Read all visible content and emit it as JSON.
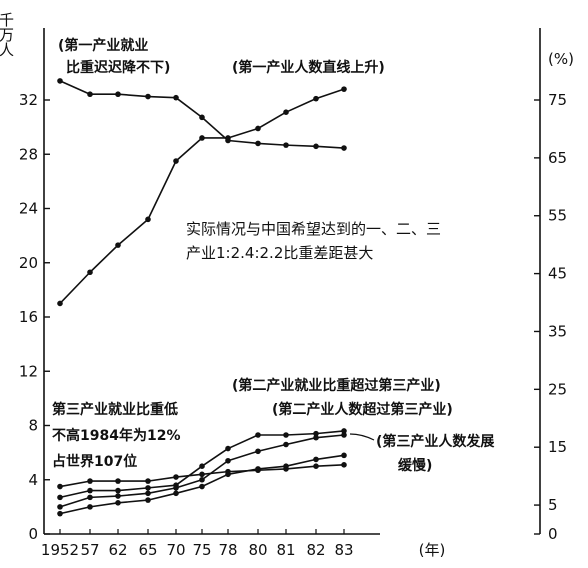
{
  "chart_data": {
    "type": "line",
    "left_axis": {
      "unit": "千万人",
      "ylim": [
        0,
        36
      ],
      "ticks": [
        0,
        4,
        8,
        12,
        16,
        20,
        24,
        28,
        32
      ]
    },
    "right_axis": {
      "unit": "(%)",
      "ylim": [
        0,
        85
      ],
      "ticks": [
        0,
        5,
        15,
        25,
        35,
        45,
        55,
        65,
        75
      ]
    },
    "x_labels": [
      "1952",
      "57",
      "62",
      "65",
      "70",
      "75",
      "78",
      "80",
      "81",
      "82",
      "83",
      "(年)"
    ],
    "categories": [
      "1952",
      "57",
      "62",
      "65",
      "70",
      "75",
      "78",
      "80",
      "81",
      "82",
      "83"
    ],
    "series": [
      {
        "axis": "left",
        "values": [
          17.0,
          19.3,
          21.3,
          23.2,
          27.5,
          29.2,
          29.2,
          29.9,
          31.1,
          32.1,
          32.8
        ]
      },
      {
        "axis": "right",
        "values": [
          78.3,
          76.0,
          76.0,
          75.6,
          75.4,
          72.0,
          68.0,
          67.5,
          67.2,
          67.0,
          66.7
        ]
      },
      {
        "axis": "left",
        "values": [
          3.5,
          3.9,
          3.9,
          3.9,
          4.2,
          4.4,
          4.6,
          4.7,
          4.8,
          5.0,
          5.1
        ]
      },
      {
        "axis": "left",
        "values": [
          2.7,
          3.2,
          3.2,
          3.4,
          3.6,
          5.0,
          6.3,
          7.3,
          7.3,
          7.4,
          7.6
        ]
      },
      {
        "axis": "left",
        "values": [
          2.0,
          2.7,
          2.8,
          3.0,
          3.4,
          4.0,
          5.4,
          6.1,
          6.6,
          7.1,
          7.3
        ]
      },
      {
        "axis": "left",
        "values": [
          1.5,
          2.0,
          2.3,
          2.5,
          3.0,
          3.5,
          4.4,
          4.8,
          5.0,
          5.5,
          5.8
        ]
      }
    ],
    "annotations": {
      "primary_share_slow": [
        "(第一产业就业",
        "比重迟迟降不下)"
      ],
      "primary_number_rises": "(第一产业人数直线上升)",
      "center_note": [
        "实际情况与中国希望达到的一、二、三",
        "产业1:2.4:2.2比重差距甚大"
      ],
      "tertiary_share_slow": [
        "第三产业就业比重低",
        "不高1984年为12%",
        "占世界107位"
      ],
      "secondary_share_exceeds": "(第二产业就业比重超过第三产业)",
      "secondary_number_exceeds": "(第二产业人数超过第三产业)",
      "tertiary_number_slow": [
        "(第三产业人数发展",
        "缓慢)"
      ]
    }
  }
}
